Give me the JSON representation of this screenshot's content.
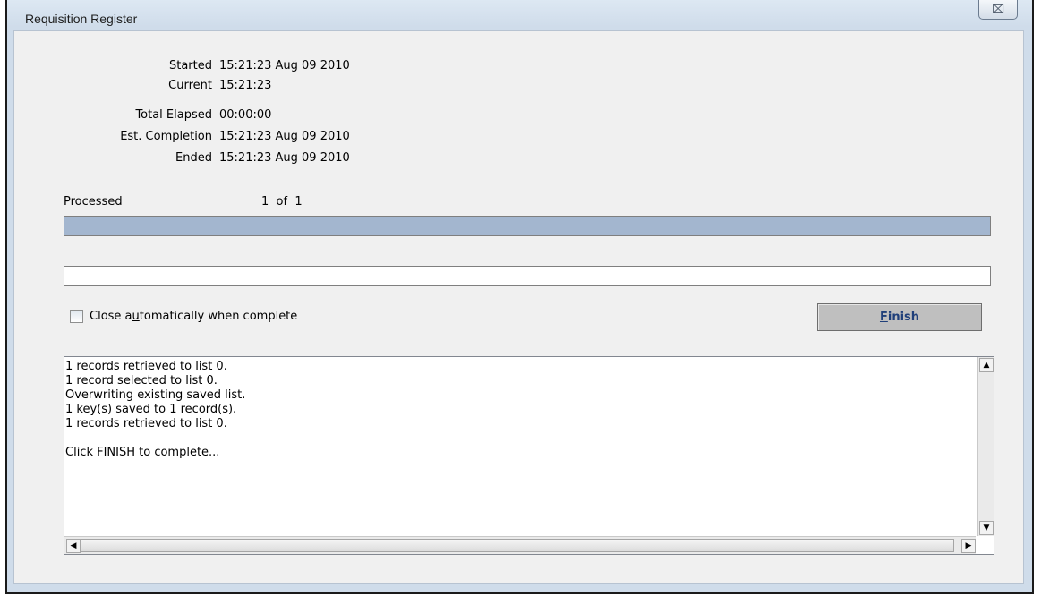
{
  "window": {
    "title": "Requisition Register",
    "close_glyph": "⌧",
    "close_icon": "close-icon"
  },
  "info": {
    "started_label": "Started",
    "started_value": "15:21:23 Aug 09 2010",
    "current_label": "Current",
    "current_value": "15:21:23",
    "elapsed_label": "Total Elapsed",
    "elapsed_value": "00:00:00",
    "completion_label": "Est. Completion",
    "completion_value": "15:21:23 Aug 09 2010",
    "ended_label": "Ended",
    "ended_value": "15:21:23 Aug 09 2010"
  },
  "progress": {
    "label": "Processed",
    "count": "1  of  1",
    "fraction": 1.0,
    "fill_color": "#a3b6cf",
    "status_text": ""
  },
  "options": {
    "auto_close_label_before": "Close a",
    "auto_close_mnemonic": "u",
    "auto_close_label_after": "tomatically when complete",
    "auto_close_checked": false
  },
  "finish": {
    "mnemonic": "F",
    "label_rest": "inish"
  },
  "log": {
    "lines": [
      "1 records retrieved to list 0.",
      "1 record selected to list 0.",
      "Overwriting existing saved list.",
      "1 key(s) saved to 1 record(s).",
      "1 records retrieved to list 0.",
      "",
      "Click FINISH to complete..."
    ]
  },
  "icons": {
    "up": "▲",
    "down": "▼",
    "left": "◀",
    "right": "▶"
  }
}
